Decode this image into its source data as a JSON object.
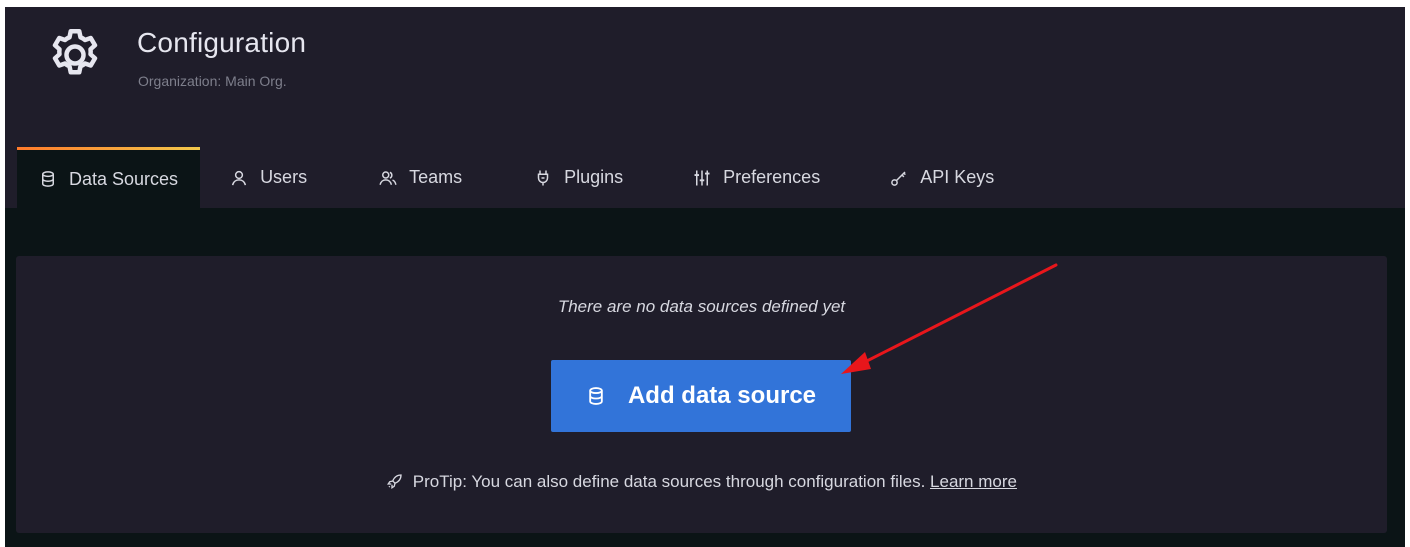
{
  "header": {
    "title": "Configuration",
    "subtitle": "Organization: Main Org.",
    "icon": "gear-icon"
  },
  "tabs": [
    {
      "label": "Data Sources",
      "icon": "database-icon",
      "active": true
    },
    {
      "label": "Users",
      "icon": "user-icon",
      "active": false
    },
    {
      "label": "Teams",
      "icon": "users-icon",
      "active": false
    },
    {
      "label": "Plugins",
      "icon": "plug-icon",
      "active": false
    },
    {
      "label": "Preferences",
      "icon": "sliders-icon",
      "active": false
    },
    {
      "label": "API Keys",
      "icon": "key-icon",
      "active": false
    }
  ],
  "empty_state": {
    "message": "There are no data sources defined yet",
    "button_label": "Add data source",
    "button_icon": "database-icon",
    "protip_text": "ProTip: You can also define data sources through configuration files.",
    "protip_icon": "rocket-icon",
    "learn_more_label": "Learn more"
  },
  "colors": {
    "header_bg": "#1f1d2a",
    "page_bg": "#0b1416",
    "button_blue": "#3274d9",
    "tab_accent_start": "#ff7a2a",
    "tab_accent_end": "#f2c94c",
    "annotation_arrow": "#e8161b"
  }
}
